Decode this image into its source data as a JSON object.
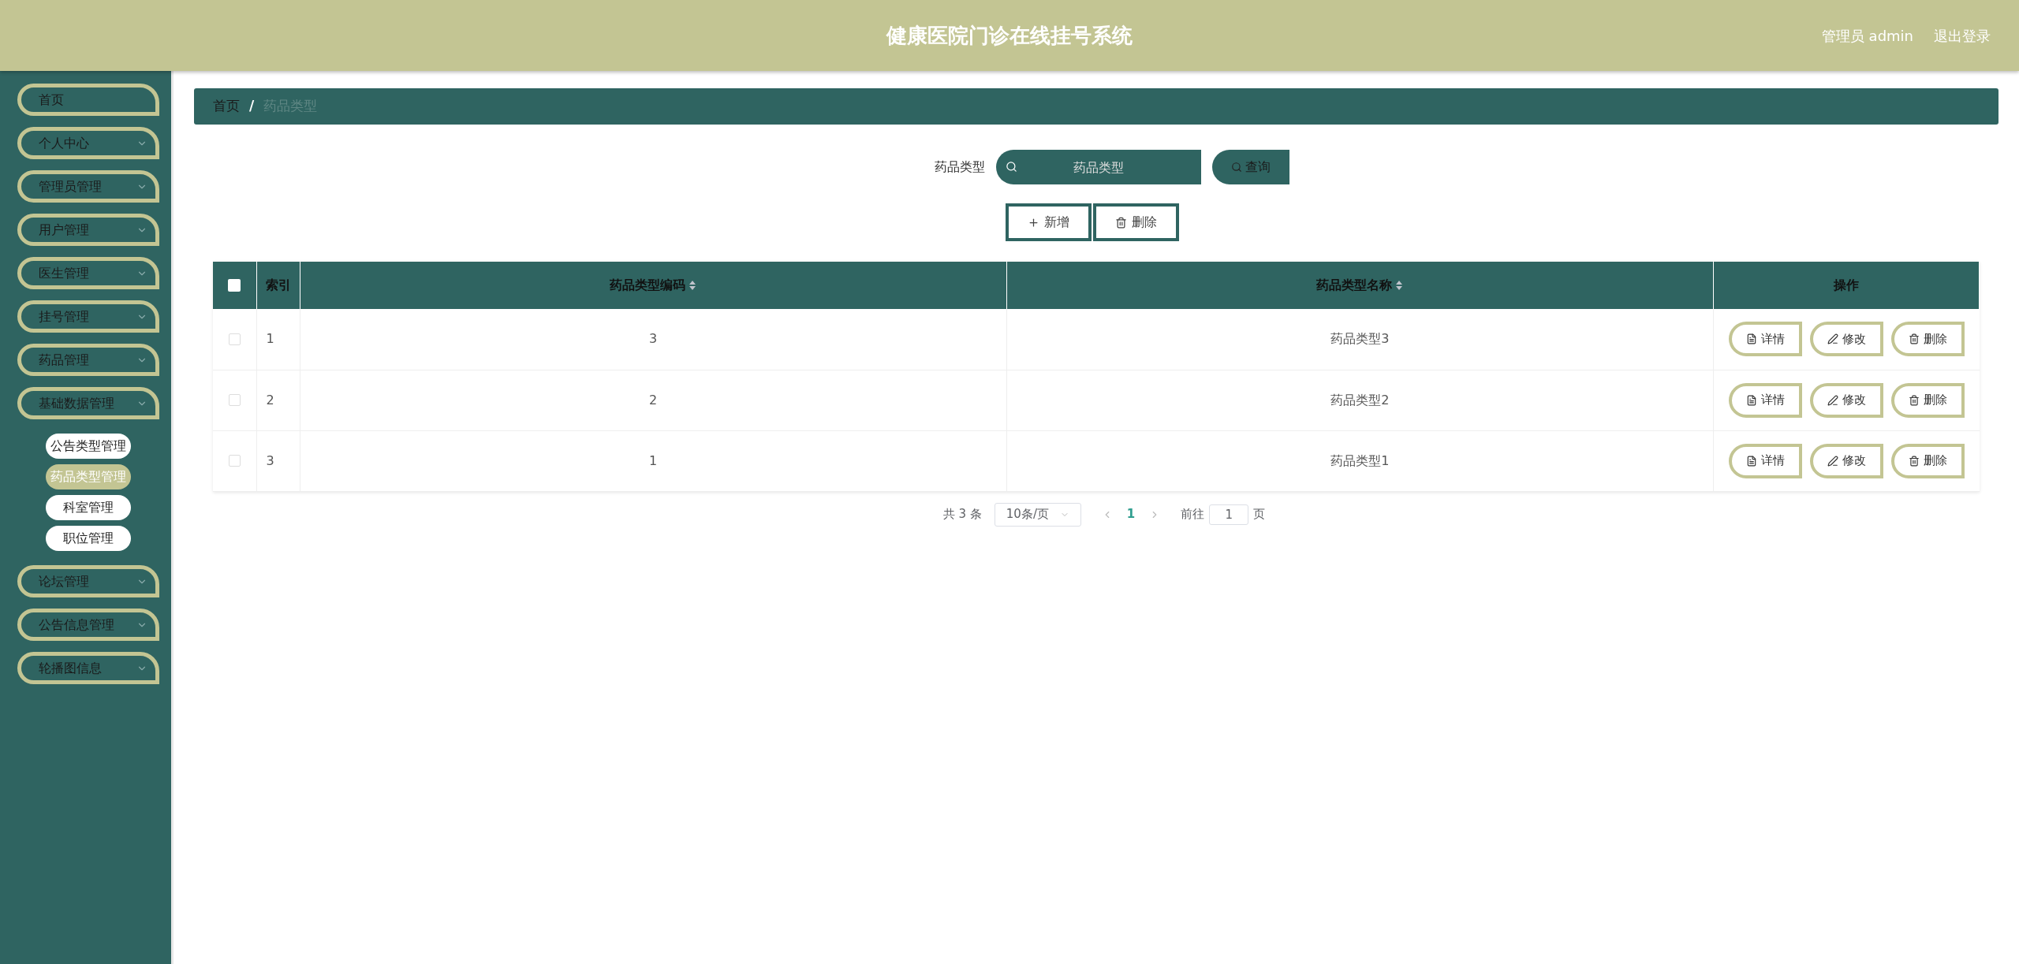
{
  "header": {
    "title": "健康医院门诊在线挂号系统",
    "user": "管理员 admin",
    "logout": "退出登录"
  },
  "sidebar": {
    "items": [
      {
        "label": "首页",
        "dropdown": false
      },
      {
        "label": "个人中心",
        "dropdown": true
      },
      {
        "label": "管理员管理",
        "dropdown": true
      },
      {
        "label": "用户管理",
        "dropdown": true
      },
      {
        "label": "医生管理",
        "dropdown": true
      },
      {
        "label": "挂号管理",
        "dropdown": true
      },
      {
        "label": "药品管理",
        "dropdown": true
      },
      {
        "label": "基础数据管理",
        "dropdown": true,
        "children": [
          {
            "label": "公告类型管理",
            "selected": false
          },
          {
            "label": "药品类型管理",
            "selected": true
          },
          {
            "label": "科室管理",
            "selected": false
          },
          {
            "label": "职位管理",
            "selected": false
          }
        ]
      },
      {
        "label": "论坛管理",
        "dropdown": true
      },
      {
        "label": "公告信息管理",
        "dropdown": true
      },
      {
        "label": "轮播图信息",
        "dropdown": true
      }
    ]
  },
  "breadcrumb": {
    "separator": "/",
    "items": [
      "首页",
      "药品类型"
    ]
  },
  "search": {
    "label": "药品类型",
    "placeholder": "药品类型",
    "button": "查询"
  },
  "actions": [
    "新增",
    "删除"
  ],
  "table": {
    "header_checked": false,
    "columns": [
      {
        "label": "索引",
        "sortable": false
      },
      {
        "label": "药品类型编码",
        "sortable": true
      },
      {
        "label": "药品类型名称",
        "sortable": true
      },
      {
        "label": "操作",
        "sortable": false
      }
    ],
    "rows": [
      {
        "checked": false,
        "index": "1",
        "code": "3",
        "name": "药品类型3",
        "buttons": [
          "详情",
          "修改",
          "删除"
        ]
      },
      {
        "checked": false,
        "index": "2",
        "code": "2",
        "name": "药品类型2",
        "buttons": [
          "详情",
          "修改",
          "删除"
        ]
      },
      {
        "checked": false,
        "index": "3",
        "code": "1",
        "name": "药品类型1",
        "buttons": [
          "详情",
          "修改",
          "删除"
        ]
      }
    ]
  },
  "pagination": {
    "total": "共 3 条",
    "page_size": "10条/页",
    "pages": [
      {
        "label": "1",
        "selected": true
      }
    ],
    "goto_label": "前往",
    "goto_value": "1",
    "goto_suffix": "页"
  }
}
